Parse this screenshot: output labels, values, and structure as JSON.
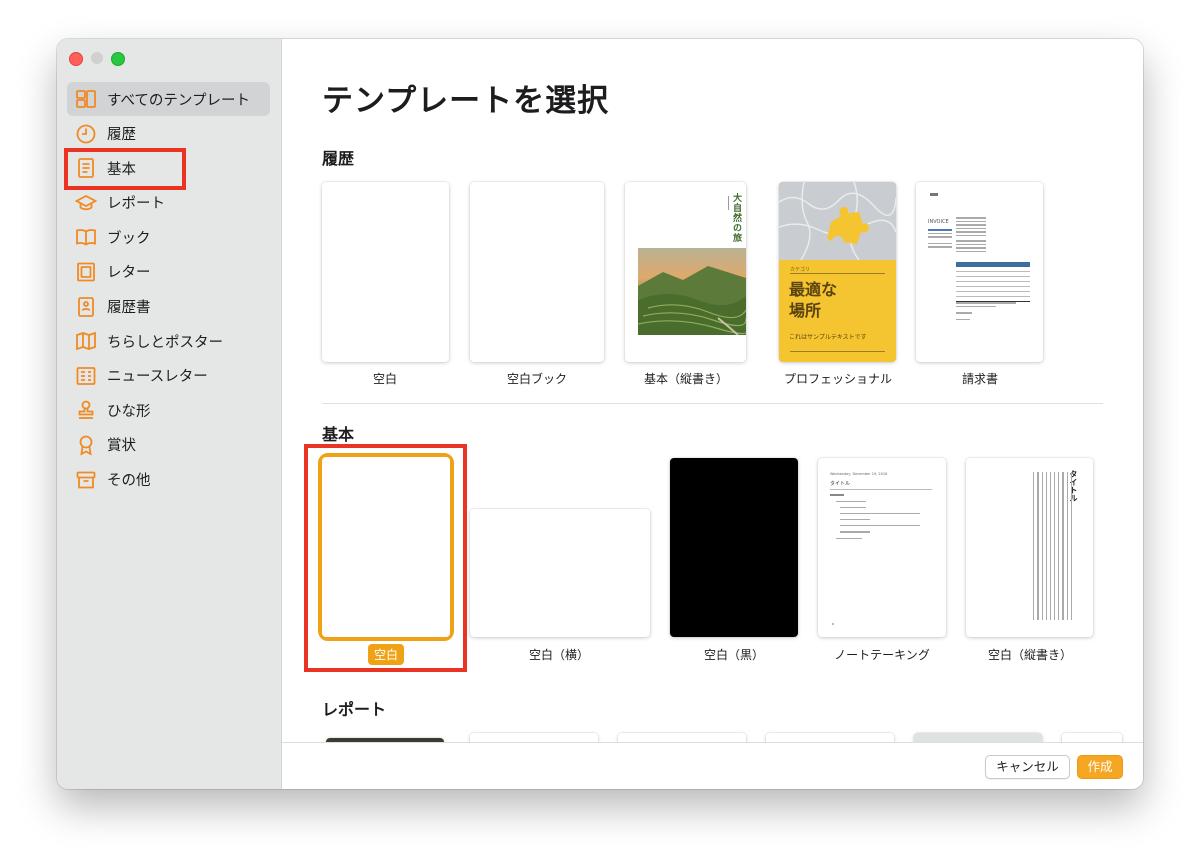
{
  "sidebar": {
    "items": [
      {
        "label": "すべてのテンプレート",
        "icon": "all-templates-icon"
      },
      {
        "label": "履歴",
        "icon": "clock-icon"
      },
      {
        "label": "基本",
        "icon": "document-icon"
      },
      {
        "label": "レポート",
        "icon": "graduation-cap-icon"
      },
      {
        "label": "ブック",
        "icon": "book-icon"
      },
      {
        "label": "レター",
        "icon": "letter-icon"
      },
      {
        "label": "履歴書",
        "icon": "resume-icon"
      },
      {
        "label": "ちらしとポスター",
        "icon": "map-icon"
      },
      {
        "label": "ニュースレター",
        "icon": "newsletter-icon"
      },
      {
        "label": "ひな形",
        "icon": "stamp-icon"
      },
      {
        "label": "賞状",
        "icon": "award-icon"
      },
      {
        "label": "その他",
        "icon": "archive-icon"
      }
    ]
  },
  "main": {
    "title": "テンプレートを選択",
    "sections": {
      "history": {
        "title": "履歴",
        "templates": [
          {
            "label": "空白"
          },
          {
            "label": "空白ブック"
          },
          {
            "label": "基本（縦書き）",
            "vertical_title": "大自然の旅"
          },
          {
            "label": "プロフェッショナル",
            "heading": "最適な場所",
            "subtitle": "これはサンプルテキストです",
            "tag": "カテゴリ"
          },
          {
            "label": "請求書",
            "heading": "INVOICE"
          }
        ]
      },
      "basic": {
        "title": "基本",
        "templates": [
          {
            "label": "空白",
            "selected": true
          },
          {
            "label": "空白（横）"
          },
          {
            "label": "空白（黒）"
          },
          {
            "label": "ノートテーキング",
            "date": "Wednesday, December 19, 2018",
            "heading": "タイトル"
          },
          {
            "label": "空白（縦書き）",
            "vertical_title": "タイトル"
          }
        ]
      },
      "report": {
        "title": "レポート"
      }
    }
  },
  "footer": {
    "cancel_label": "キャンセル",
    "create_label": "作成"
  },
  "colors": {
    "accent": "#f0a216",
    "icon": "#f08a24",
    "annotation": "#ea3323",
    "sidebar_bg": "#e5e7e7"
  }
}
